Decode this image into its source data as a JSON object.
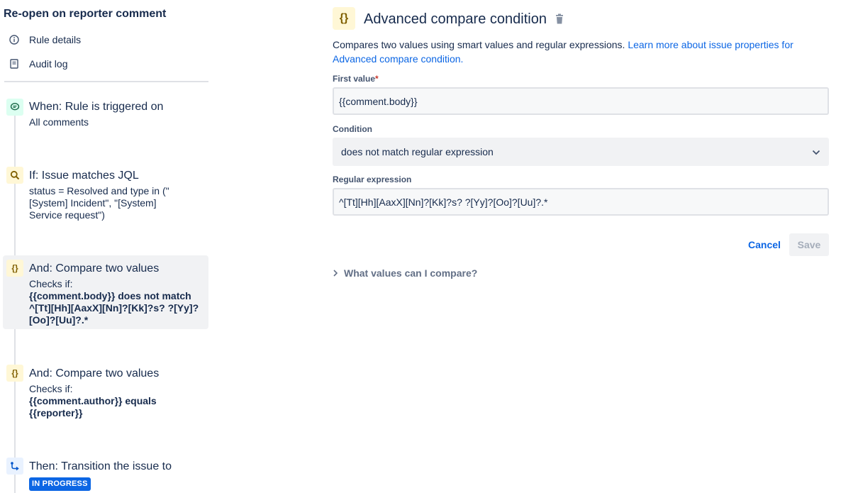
{
  "sidebar": {
    "rule_title": "Re-open on reporter comment",
    "nav": [
      {
        "label": "Rule details",
        "icon": "info-icon"
      },
      {
        "label": "Audit log",
        "icon": "document-icon"
      }
    ],
    "steps": [
      {
        "icon": "comment-icon",
        "title": "When: Rule is triggered on",
        "desc": "All comments"
      },
      {
        "icon": "search-icon",
        "title": "If: Issue matches JQL",
        "desc": "status = Resolved and type in (\"[System] Incident\", \"[System] Service request\")"
      },
      {
        "icon": "braces-icon",
        "badge_text": "{}",
        "title": "And: Compare two values",
        "desc_prefix": "Checks if:",
        "desc_bold": "{{comment.body}} does not match ^[Tt][Hh][AaxX][Nn]?[Kk]?s? ?[Yy]?[Oo]?[Uu]?.*"
      },
      {
        "icon": "braces-icon",
        "badge_text": "{}",
        "title": "And: Compare two values",
        "desc_prefix": "Checks if:",
        "desc_bold": "{{comment.author}} equals {{reporter}}"
      },
      {
        "icon": "transition-icon",
        "title": "Then: Transition the issue to",
        "lozenge": "IN PROGRESS"
      }
    ]
  },
  "panel": {
    "badge_text": "{}",
    "title": "Advanced compare condition",
    "intro_text": "Compares two values using smart values and regular expressions. ",
    "intro_link": "Learn more about issue properties for Advanced compare condition.",
    "first_value": {
      "label": "First value",
      "required_mark": "*",
      "value": "{{comment.body}}"
    },
    "condition": {
      "label": "Condition",
      "selected": "does not match regular expression"
    },
    "regex": {
      "label": "Regular expression",
      "value": "^[Tt][Hh][AaxX][Nn]?[Kk]?s? ?[Yy]?[Oo]?[Uu]?.*"
    },
    "cancel_label": "Cancel",
    "save_label": "Save",
    "expander_label": "What values can I compare?"
  }
}
